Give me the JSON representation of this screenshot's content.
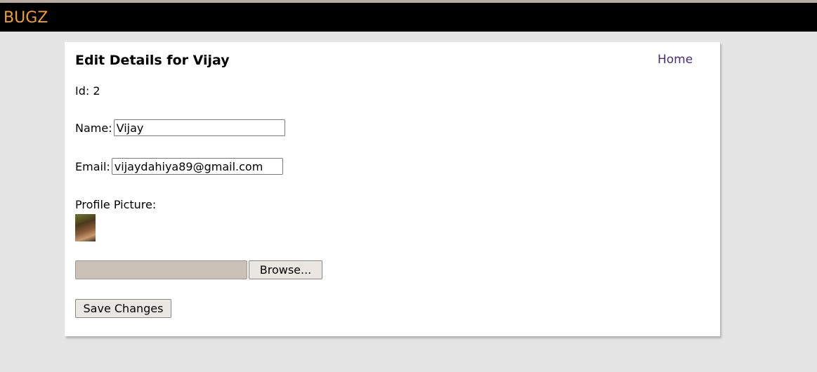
{
  "header": {
    "brand": "BUGZ"
  },
  "page": {
    "title": "Edit Details for Vijay",
    "home_link": "Home"
  },
  "form": {
    "id_label": "Id:",
    "id_value": "2",
    "name_label": "Name:",
    "name_value": "Vijay",
    "email_label": "Email:",
    "email_value": "vijaydahiya89@gmail.com",
    "picture_label": "Profile Picture:",
    "browse_label": "Browse...",
    "save_label": "Save Changes"
  },
  "colors": {
    "brand": "#f0a030",
    "header_bg": "#000000",
    "link": "#4a2c7a",
    "page_bg": "#e5e5e5"
  }
}
